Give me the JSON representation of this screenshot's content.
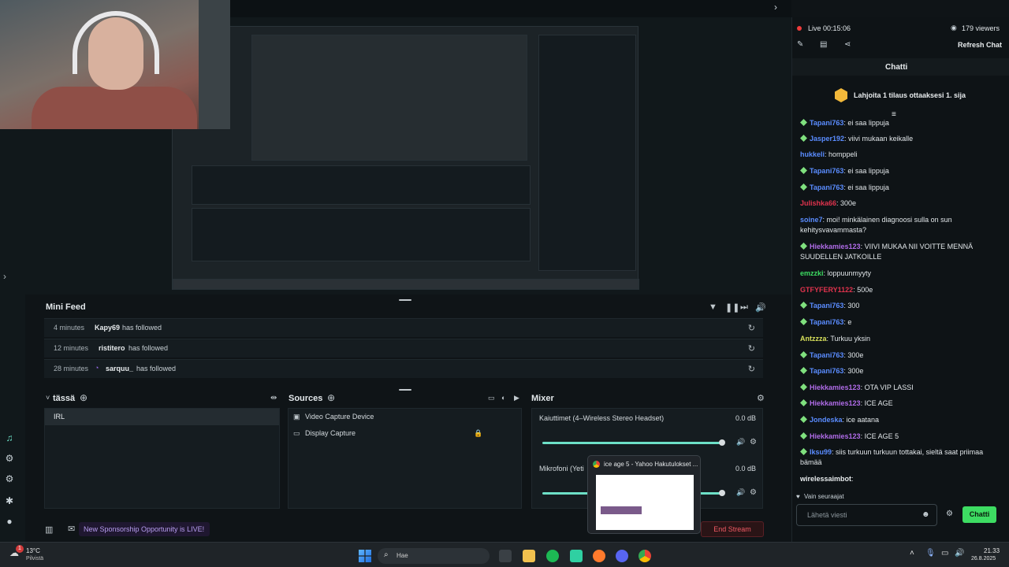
{
  "window": {
    "chat_tab_title": "Chatti"
  },
  "chat": {
    "live_label": "Live 00:15:06",
    "viewers": "179 viewers",
    "refresh_label": "Refresh Chat",
    "title": "Chatti",
    "gift_banner": "Lahjoita 1 tilaus ottaaksesi 1. sija",
    "messages": [
      {
        "user": "Tapani763",
        "text": ": ei saa lippuja",
        "color": "#5a8cff",
        "badge": true
      },
      {
        "user": "Jasper192",
        "text": ": viivi mukaan keikalle",
        "color": "#5a8cff",
        "badge": true
      },
      {
        "user": "hukkeli",
        "text": ": homppeli",
        "color": "#5a8cff",
        "badge": false
      },
      {
        "user": "Tapani763",
        "text": ": ei saa lippuja",
        "color": "#5a8cff",
        "badge": true
      },
      {
        "user": "Tapani763",
        "text": ": ei saa lippuja",
        "color": "#5a8cff",
        "badge": true
      },
      {
        "user": "Julishka66",
        "text": ": 300e",
        "color": "#e0334d",
        "badge": false
      },
      {
        "user": "soine7",
        "text": ": moi! minkälainen diagnoosi sulla on sun kehitysvavammasta?",
        "color": "#5a8cff",
        "badge": false
      },
      {
        "user": "Hiekkamies123",
        "text": ": VIIVI MUKAA NII VOITTE MENNÄ SUUDELLEN JATKOILLE",
        "color": "#b06ce8",
        "badge": true
      },
      {
        "user": "emzzki",
        "text": ": loppuunmyyty",
        "color": "#3ddc62",
        "badge": false
      },
      {
        "user": "GTFYFERY1122",
        "text": ": 500e",
        "color": "#e0334d",
        "badge": false
      },
      {
        "user": "Tapani763",
        "text": ": 300",
        "color": "#5a8cff",
        "badge": true
      },
      {
        "user": "Tapani763",
        "text": ": e",
        "color": "#5a8cff",
        "badge": true
      },
      {
        "user": "Antzzza",
        "text": ": Turkuu yksin",
        "color": "#d7e05a",
        "badge": false
      },
      {
        "user": "Tapani763",
        "text": ": 300e",
        "color": "#5a8cff",
        "badge": true
      },
      {
        "user": "Tapani763",
        "text": ": 300e",
        "color": "#5a8cff",
        "badge": true
      },
      {
        "user": "Hiekkamies123",
        "text": ": OTA VIP LASSI",
        "color": "#b06ce8",
        "badge": true
      },
      {
        "user": "Hiekkamies123",
        "text": ": ICE AGE",
        "color": "#b06ce8",
        "badge": true
      },
      {
        "user": "Jondeska",
        "text": ": ice aatana",
        "color": "#5a8cff",
        "badge": true
      },
      {
        "user": "Hiekkamies123",
        "text": ": ICE AGE 5",
        "color": "#b06ce8",
        "badge": true
      },
      {
        "user": "Iksu99",
        "text": ": siis turkuun turkuun tottakai, sieltä saat priimaa bämää",
        "color": "#5a8cff",
        "badge": true
      },
      {
        "user": "wirelessaimbot",
        "text": ":",
        "color": "#e8ecee",
        "badge": false
      }
    ],
    "followers_only": "Vain seuraajat",
    "input_placeholder": "Lähetä viesti",
    "send_label": "Chatti"
  },
  "minifeed": {
    "title": "Mini Feed",
    "rows": [
      {
        "time": "4 minutes",
        "user": "Kapy69",
        "action": "has followed"
      },
      {
        "time": "12 minutes",
        "user": "ristitero",
        "action": "has followed"
      },
      {
        "time": "28 minutes",
        "user": "sarquu_",
        "action": "has followed"
      }
    ]
  },
  "scenes": {
    "title": "tässä",
    "items": [
      "IRL"
    ]
  },
  "sources": {
    "title": "Sources",
    "items": [
      "Video Capture Device",
      "Display Capture"
    ]
  },
  "mixer": {
    "title": "Mixer",
    "channels": [
      {
        "name": "Kaiuttimet (4–Wireless Stereo Headset)",
        "db": "0.0 dB",
        "level": 0.92
      },
      {
        "name": "Mikrofoni (Yeti",
        "db": "0.0 dB",
        "level": 0.92
      }
    ]
  },
  "status": {
    "sponsor": "New Sponsorship Opportunity is LIVE!",
    "end_stream": "End Stream"
  },
  "tab_preview": {
    "title": "ice age 5 - Yahoo Hakutulokset ..."
  },
  "taskbar": {
    "weather_temp": "13°C",
    "weather_desc": "Pilvistä",
    "search_placeholder": "Hae",
    "time": "21.33",
    "date": "26.8.2025",
    "notif_count": "1"
  }
}
